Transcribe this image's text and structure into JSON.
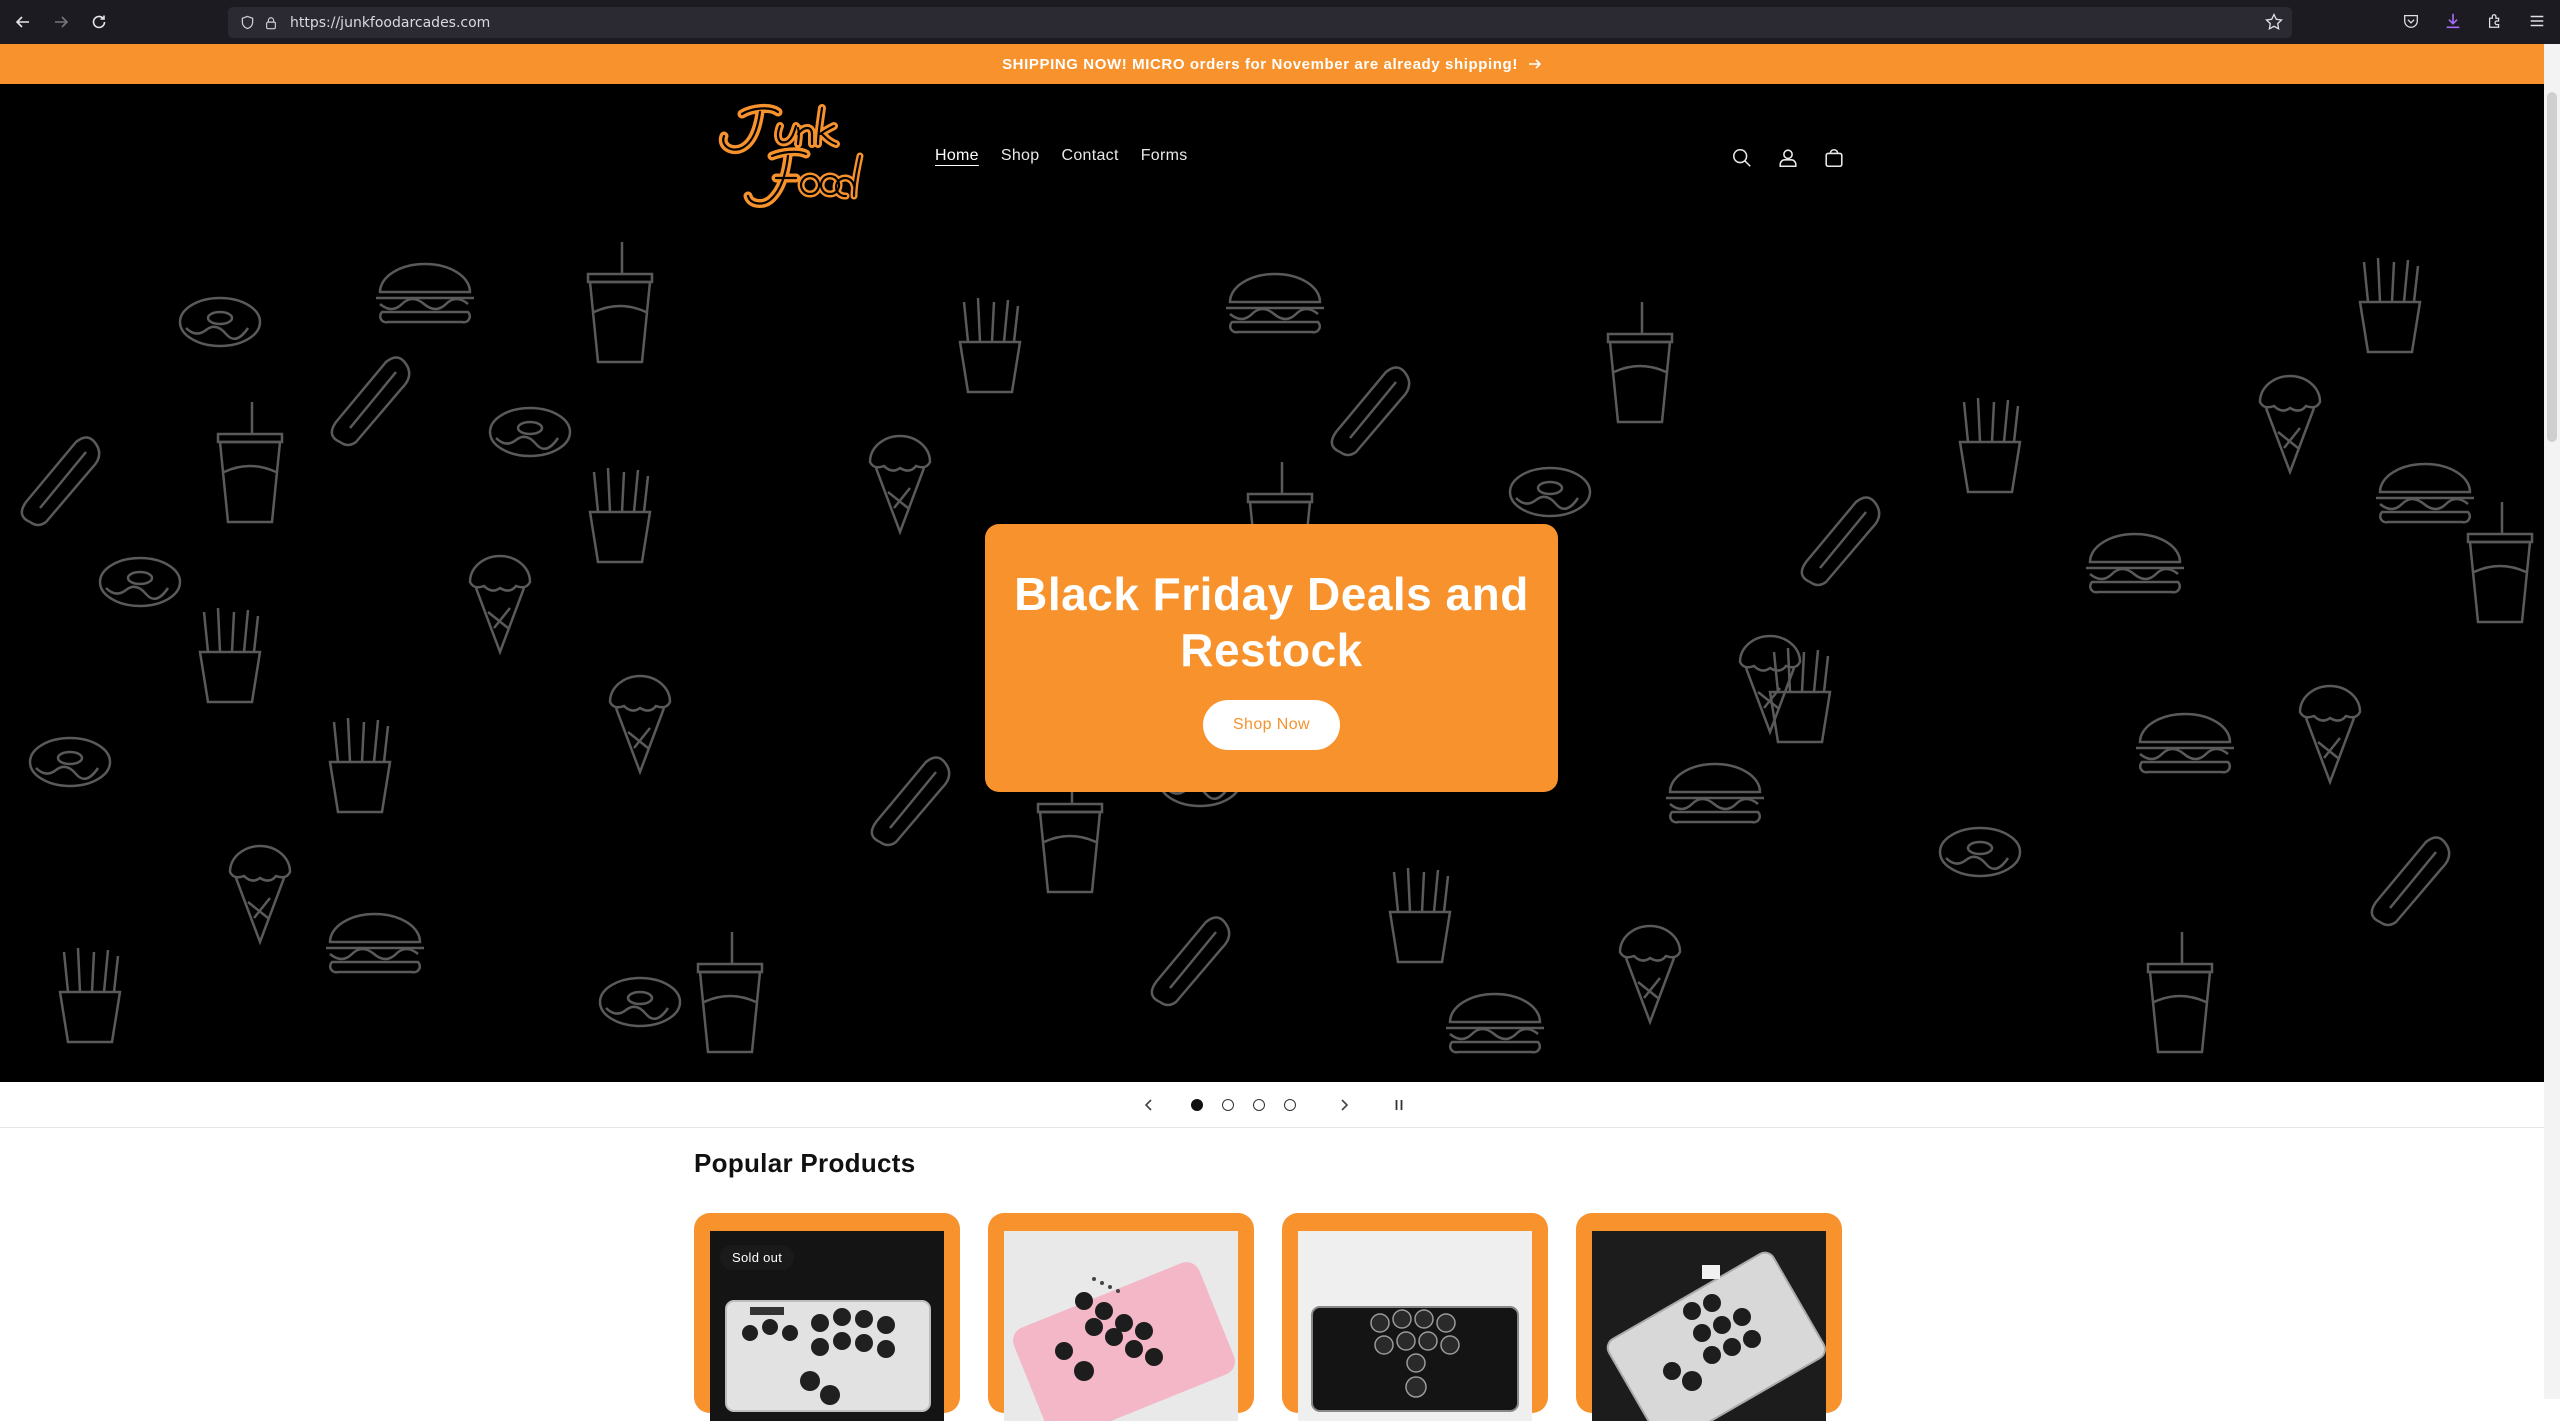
{
  "browser": {
    "url": "https://junkfoodarcades.com"
  },
  "announcement": {
    "text": "SHIPPING NOW! MICRO orders for November are already shipping!"
  },
  "header": {
    "logo_text": "Junk Food",
    "nav": [
      {
        "label": "Home",
        "active": true
      },
      {
        "label": "Shop",
        "active": false
      },
      {
        "label": "Contact",
        "active": false
      },
      {
        "label": "Forms",
        "active": false
      }
    ],
    "icons": [
      "search-icon",
      "account-icon",
      "cart-icon"
    ]
  },
  "hero": {
    "title": "Black Friday Deals and Restock",
    "button_label": "Shop Now",
    "slides": 4,
    "active_slide": 1
  },
  "products_section": {
    "title": "Popular Products",
    "items": [
      {
        "badge": "Sold out",
        "image": "clear-leverless-controller"
      },
      {
        "badge": "",
        "image": "pink-leverless-controller"
      },
      {
        "badge": "",
        "image": "black-leverless-controller"
      },
      {
        "badge": "",
        "image": "clear-leverless-controller-angled"
      }
    ]
  },
  "colors": {
    "accent": "#f7922c",
    "header_bg": "#000000",
    "chrome_bg": "#1c1b22"
  }
}
